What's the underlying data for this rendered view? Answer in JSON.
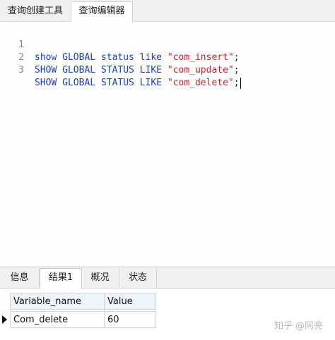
{
  "top_tabs": [
    "查询创建工具",
    "查询编辑器"
  ],
  "editor": {
    "lines": [
      {
        "num": "1",
        "parts": [
          {
            "t": "show GLOBAL status like ",
            "c": "kw"
          },
          {
            "t": "\"com_insert\"",
            "c": "str"
          },
          {
            "t": ";",
            "c": "punc"
          }
        ]
      },
      {
        "num": "2",
        "parts": [
          {
            "t": "SHOW GLOBAL STATUS LIKE ",
            "c": "kw"
          },
          {
            "t": "\"com_update\"",
            "c": "str"
          },
          {
            "t": ";",
            "c": "punc"
          }
        ]
      },
      {
        "num": "3",
        "parts": [
          {
            "t": "SHOW GLOBAL STATUS LIKE ",
            "c": "kw"
          },
          {
            "t": "\"com_delete\"",
            "c": "str"
          },
          {
            "t": ";",
            "c": "punc"
          }
        ]
      }
    ]
  },
  "bottom_tabs": [
    "信息",
    "结果1",
    "概况",
    "状态"
  ],
  "results": {
    "columns": [
      "Variable_name",
      "Value"
    ],
    "rows": [
      [
        "Com_delete",
        "60"
      ]
    ]
  },
  "watermark": "知乎 @阿亮"
}
